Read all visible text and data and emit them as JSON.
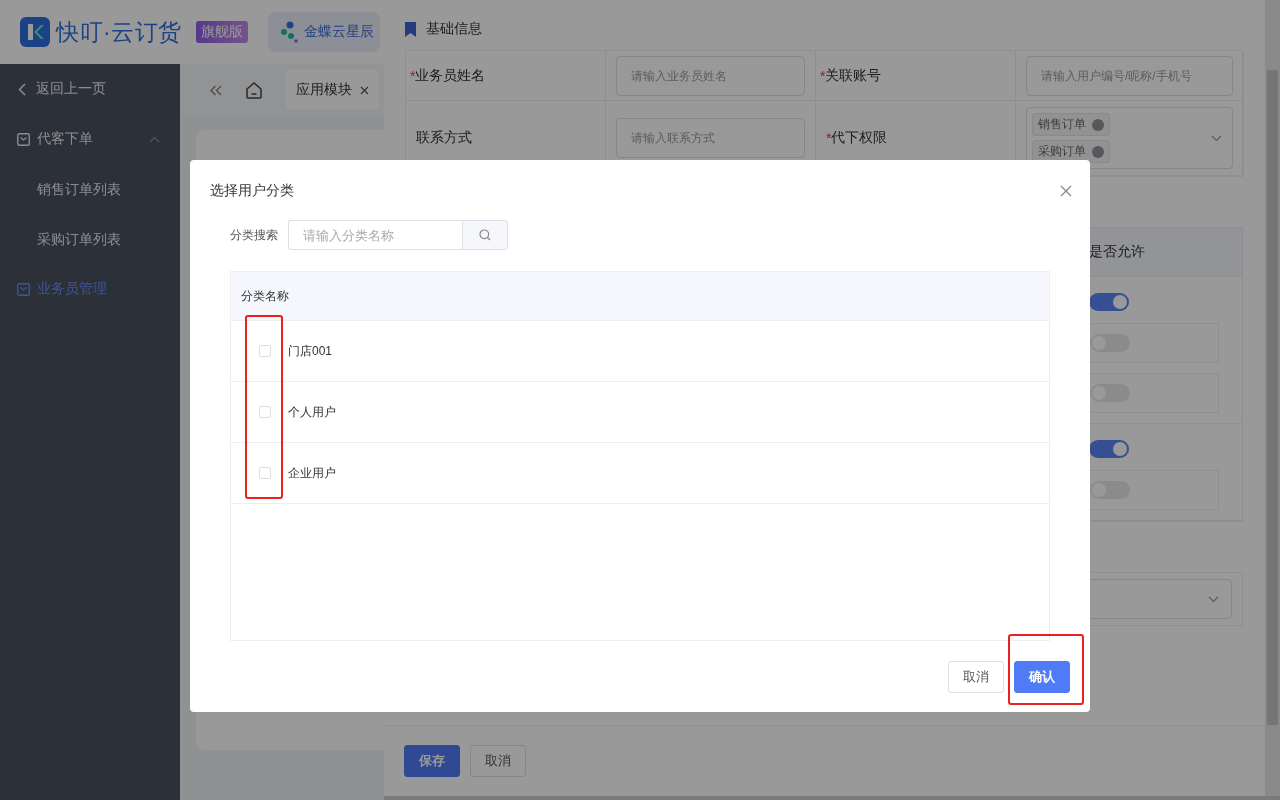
{
  "header": {
    "logo_text": "快叮·云订货",
    "edition_badge": "旗舰版",
    "app_tab": "金蝶云星辰"
  },
  "sidebar": {
    "back": "返回上一页",
    "items": [
      {
        "label": "代客下单",
        "selected": false,
        "expanded": true,
        "children": [
          {
            "label": "销售订单列表",
            "selected": false
          },
          {
            "label": "采购订单列表",
            "selected": false
          }
        ]
      },
      {
        "label": "业务员管理",
        "selected": true
      }
    ]
  },
  "tabs": [
    {
      "label": "应用模块",
      "selected": true
    }
  ],
  "drawer": {
    "section_title": "基础信息",
    "form_rows": [
      {
        "fields": [
          {
            "required_mark": "*",
            "label": "业务员姓名",
            "kind": "input",
            "placeholder": "请输入业务员姓名"
          },
          {
            "required_mark": "*",
            "label": "关联账号",
            "kind": "input",
            "placeholder": "请输入用户编号/昵称/手机号"
          }
        ]
      },
      {
        "fields": [
          {
            "label": "联系方式",
            "kind": "input",
            "placeholder": "请输入联系方式"
          },
          {
            "required_mark": "*",
            "label": "代下权限",
            "kind": "tags",
            "tags": [
              "销售订单",
              "采购订单"
            ]
          }
        ]
      }
    ],
    "permissions": {
      "column": "是否允许",
      "groups": [
        {
          "on": true,
          "children": [
            {
              "on": false
            },
            {
              "on": false
            }
          ]
        },
        {
          "on": true,
          "children": [
            {
              "on": false
            }
          ]
        }
      ]
    },
    "buttons": [
      {
        "label": "保存",
        "kind": "primary"
      },
      {
        "label": "取消",
        "kind": "default"
      }
    ]
  },
  "dialog": {
    "title": "选择用户分类",
    "search_label": "分类搜索",
    "search_placeholder": "请输入分类名称",
    "column": "分类名称",
    "rows": [
      {
        "name": "门店001",
        "selected": false
      },
      {
        "name": "个人用户",
        "selected": false
      },
      {
        "name": "企业用户",
        "selected": false
      }
    ],
    "buttons": [
      {
        "label": "取消",
        "kind": "default"
      },
      {
        "label": "确认",
        "kind": "primary"
      }
    ]
  }
}
